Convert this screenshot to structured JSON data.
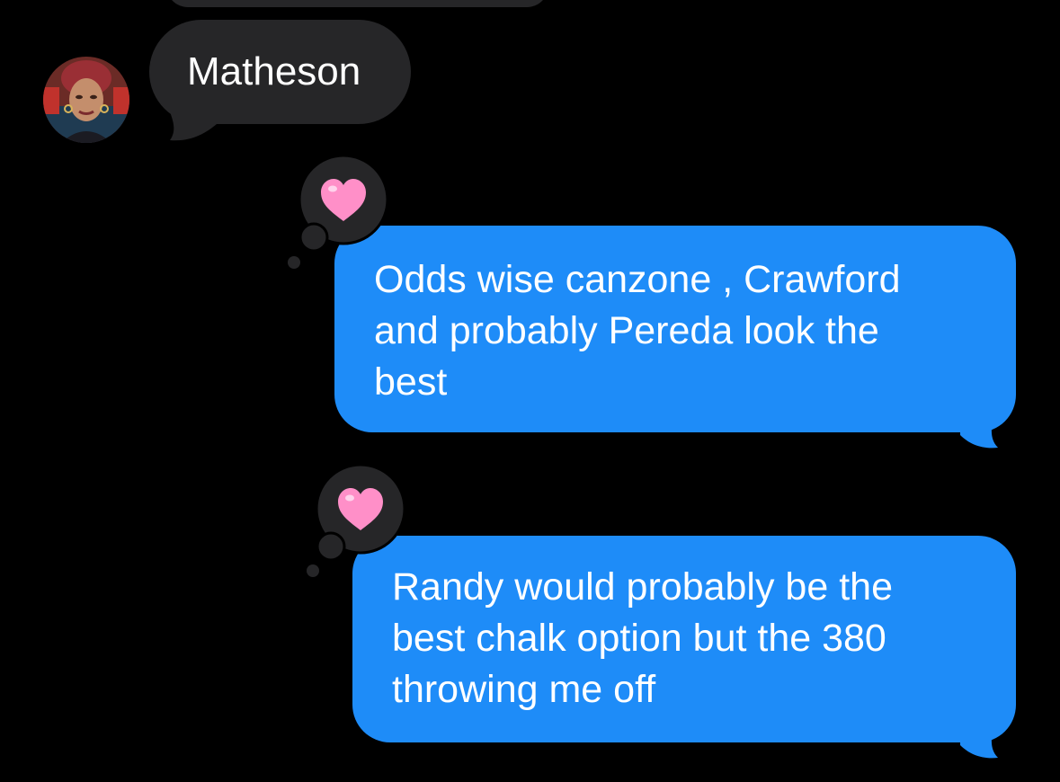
{
  "conversation": {
    "messages": [
      {
        "direction": "incoming",
        "text": "Matheson",
        "has_avatar": true
      },
      {
        "direction": "outgoing",
        "lines": [
          "Odds wise canzone , Crawford",
          "and probably Pereda look the",
          "best"
        ],
        "reaction": "heart"
      },
      {
        "direction": "outgoing",
        "lines": [
          "Randy would probably be the",
          "best chalk option but the 380",
          "throwing me off"
        ],
        "reaction": "heart"
      }
    ]
  },
  "colors": {
    "background": "#000000",
    "incoming_bubble": "#262628",
    "outgoing_bubble": "#1e8cf8",
    "heart": "#ff8fc8",
    "text": "#ffffff"
  },
  "icons": {
    "avatar": "contact-photo",
    "reaction": "heart-icon"
  }
}
